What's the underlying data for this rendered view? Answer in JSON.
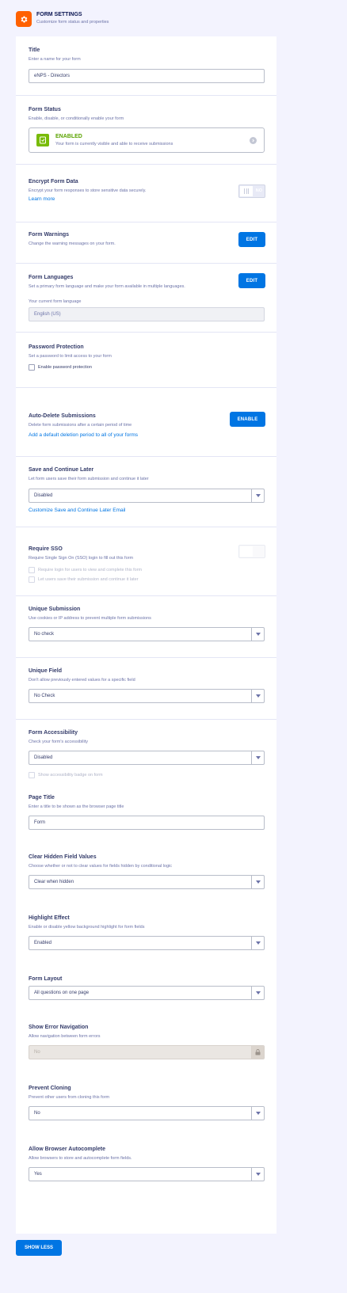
{
  "header": {
    "title": "FORM SETTINGS",
    "subtitle": "Customize form status and properties",
    "icon": "gear-icon",
    "icon_color": "#ff6100"
  },
  "title_section": {
    "label": "Title",
    "description": "Enter a name for your form",
    "value": "eNPS - Directors"
  },
  "form_status": {
    "label": "Form Status",
    "description": "Enable, disable, or conditionally enable your form",
    "status": "ENABLED",
    "status_description": "Your form is currently visible and able to receive submissions",
    "status_color": "#78bb07"
  },
  "encrypt": {
    "label": "Encrypt Form Data",
    "description": "Encrypt your form responses to store sensitive data securely.",
    "link": "Learn more",
    "toggle_label": "NO"
  },
  "warnings": {
    "label": "Form Warnings",
    "description": "Change the warning messages on your form.",
    "button": "EDIT"
  },
  "languages": {
    "label": "Form Languages",
    "description": "Set a primary form language and make your form available in multiple languages.",
    "button": "EDIT",
    "current_label": "Your current form language",
    "current_value": "English (US)"
  },
  "password": {
    "label": "Password Protection",
    "description": "Set a password to limit access to your form",
    "checkbox": "Enable password protection"
  },
  "auto_delete": {
    "label": "Auto-Delete Submissions",
    "description": "Delete form submissions after a certain period of time",
    "link": "Add a default deletion period to all of your forms",
    "button": "ENABLE"
  },
  "save_continue": {
    "label": "Save and Continue Later",
    "description": "Let form users save their form submission and continue it later",
    "value": "Disabled",
    "link": "Customize Save and Continue Later Email"
  },
  "sso": {
    "label": "Require SSO",
    "description": "Require Single Sign On (SSO) login to fill out this form",
    "option1": "Require login for users to view and complete this form",
    "option2": "Let users save their submission and continue it later"
  },
  "unique_submission": {
    "label": "Unique Submission",
    "description": "Use cookies or IP address to prevent multiple form submissions",
    "value": "No check"
  },
  "unique_field": {
    "label": "Unique Field",
    "description": "Don't allow previously entered values for a specific field",
    "value": "No Check"
  },
  "accessibility": {
    "label": "Form Accessibility",
    "description": "Check your form's accessibility",
    "value": "Disabled",
    "checkbox": "Show accessibility badge on form"
  },
  "page_title": {
    "label": "Page Title",
    "description": "Enter a title to be shown as the browser page title",
    "value": "Form"
  },
  "clear_hidden": {
    "label": "Clear Hidden Field Values",
    "description": "Choose whether or not to clear values for fields hidden by conditional logic",
    "value": "Clear when hidden"
  },
  "highlight": {
    "label": "Highlight Effect",
    "description": "Enable or disable yellow background highlight for form fields",
    "value": "Enabled"
  },
  "layout": {
    "label": "Form Layout",
    "value": "All questions on one page"
  },
  "error_nav": {
    "label": "Show Error Navigation",
    "description": "Allow navigation between form errors",
    "value": "No"
  },
  "cloning": {
    "label": "Prevent Cloning",
    "description": "Prevent other users from cloning this form",
    "value": "No"
  },
  "autocomplete": {
    "label": "Allow Browser Autocomplete",
    "description": "Allow browsers to store and autocomplete form fields.",
    "value": "Yes"
  },
  "footer": {
    "show_less": "SHOW LESS"
  },
  "accent_color": "#0075e3"
}
